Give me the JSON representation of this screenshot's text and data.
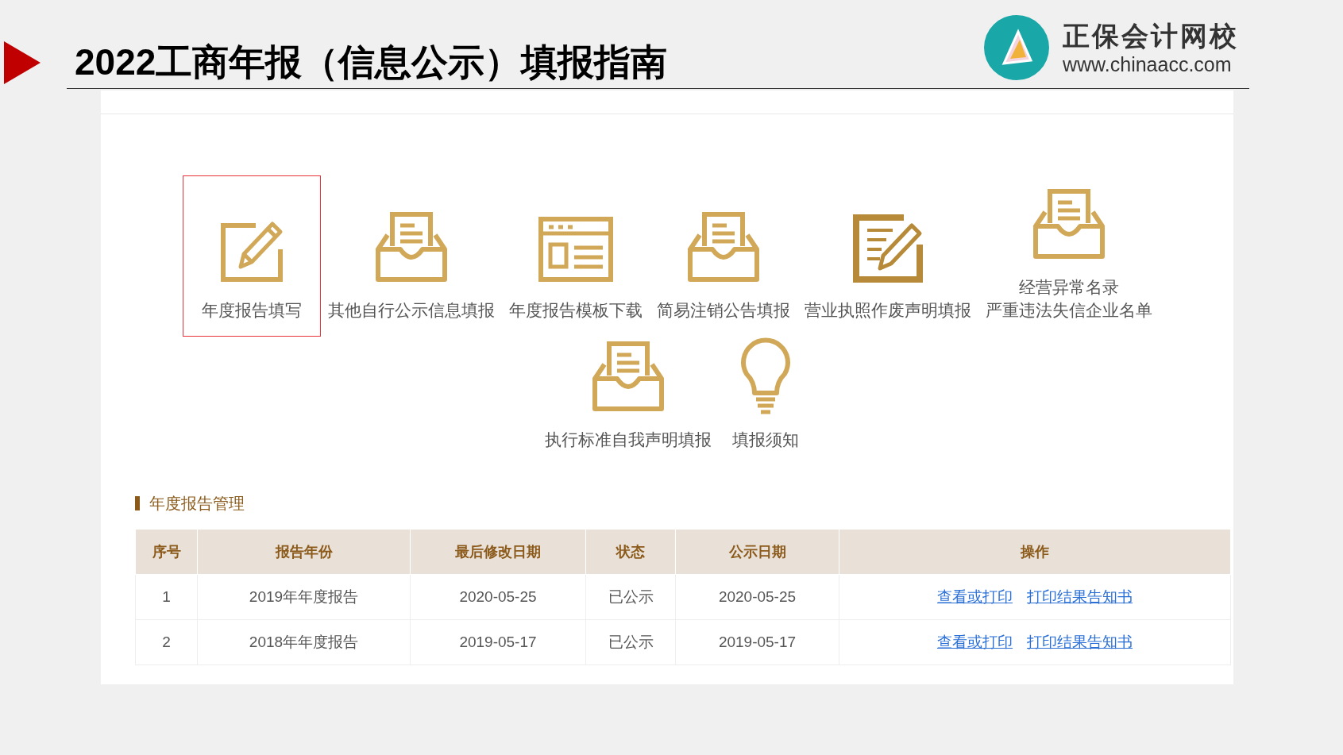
{
  "slide": {
    "title": "2022工商年报（信息公示）填报指南",
    "logo": {
      "name": "正保会计网校",
      "url": "www.chinaacc.com"
    }
  },
  "services": [
    {
      "label": "年度报告填写",
      "kind": "pen-square",
      "selected": true
    },
    {
      "label": "其他自行公示信息填报",
      "kind": "inbox-doc",
      "selected": false
    },
    {
      "label": "年度报告模板下载",
      "kind": "template",
      "selected": false
    },
    {
      "label": "简易注销公告填报",
      "kind": "inbox-doc",
      "selected": false
    },
    {
      "label": "营业执照作废声明填报",
      "kind": "pen-doc",
      "selected": false
    },
    {
      "label": [
        "经营异常名录",
        "严重违法失信企业名单"
      ],
      "kind": "inbox-doc",
      "selected": false
    },
    {
      "label": "执行标准自我声明填报",
      "kind": "inbox-doc",
      "selected": false
    },
    {
      "label": "填报须知",
      "kind": "bulb",
      "selected": false
    }
  ],
  "section_title": "年度报告管理",
  "table": {
    "columns": [
      "序号",
      "报告年份",
      "最后修改日期",
      "状态",
      "公示日期",
      "操作"
    ],
    "rows": [
      {
        "cells": [
          "1",
          "2019年年度报告",
          "2020-05-25",
          "已公示",
          "2020-05-25"
        ],
        "links": [
          "查看或打印",
          "打印结果告知书"
        ]
      },
      {
        "cells": [
          "2",
          "2018年年度报告",
          "2019-05-17",
          "已公示",
          "2019-05-17"
        ],
        "links": [
          "查看或打印",
          "打印结果告知书"
        ]
      }
    ]
  }
}
